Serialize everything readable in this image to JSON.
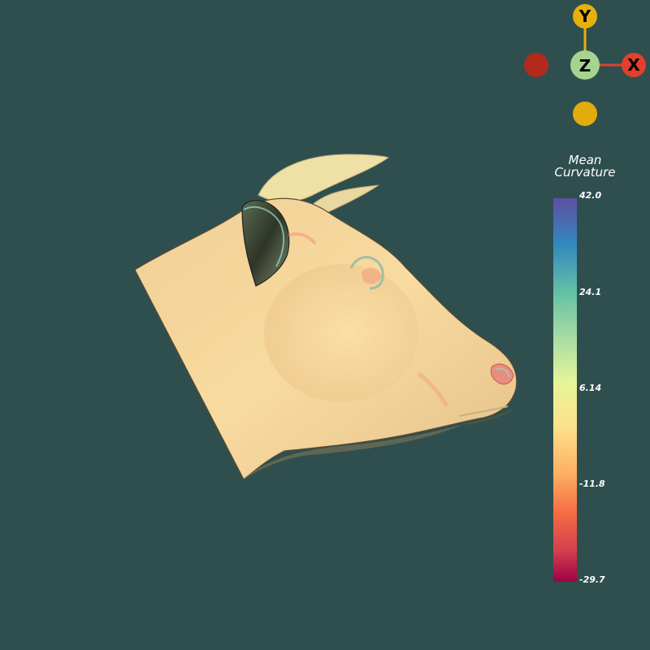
{
  "orientation_widget": {
    "axis_y_label": "Y",
    "axis_z_label": "Z",
    "axis_x_label": "X",
    "colors": {
      "y_axis": "#e6b00d",
      "x_axis": "#e0402c",
      "z_axis": "#a6d490",
      "neg_x": "#b22a1c",
      "neg_y": "#e2ad0c"
    }
  },
  "colorbar": {
    "title_line1": "Mean",
    "title_line2": "Curvature",
    "ticks": [
      "42.0",
      "24.1",
      "6.14",
      "-11.8",
      "-29.7"
    ],
    "range": [
      -29.7,
      42.0
    ],
    "colormap": "spectral"
  },
  "scene": {
    "model": "cow head",
    "background": "#2f4f4f",
    "mesh_base_color": "#f6d69a"
  }
}
